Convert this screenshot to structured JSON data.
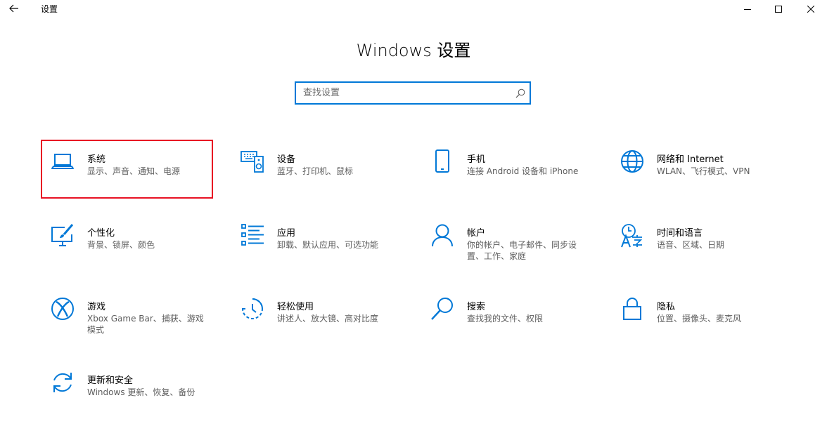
{
  "window": {
    "app_title": "设置",
    "back_icon": "back-arrow-icon",
    "minimize_icon": "minimize-icon",
    "maximize_icon": "maximize-icon",
    "close_icon": "close-icon"
  },
  "page_title": "Windows 设置",
  "search": {
    "placeholder": "查找设置",
    "value": ""
  },
  "accent_color": "#0078d7",
  "highlight_color": "#e81123",
  "selected_tile": "系统",
  "categories": [
    {
      "name": "系统",
      "desc": "显示、声音、通知、电源",
      "icon": "laptop-icon"
    },
    {
      "name": "设备",
      "desc": "蓝牙、打印机、鼠标",
      "icon": "keyboard-speaker-icon"
    },
    {
      "name": "手机",
      "desc": "连接 Android 设备和 iPhone",
      "icon": "phone-icon"
    },
    {
      "name": "网络和 Internet",
      "desc": "WLAN、飞行模式、VPN",
      "icon": "globe-icon"
    },
    {
      "name": "个性化",
      "desc": "背景、锁屏、颜色",
      "icon": "paint-monitor-icon"
    },
    {
      "name": "应用",
      "desc": "卸载、默认应用、可选功能",
      "icon": "app-list-icon"
    },
    {
      "name": "帐户",
      "desc": "你的帐户、电子邮件、同步设置、工作、家庭",
      "icon": "person-icon"
    },
    {
      "name": "时间和语言",
      "desc": "语音、区域、日期",
      "icon": "time-language-icon"
    },
    {
      "name": "游戏",
      "desc": "Xbox Game Bar、捕获、游戏模式",
      "icon": "xbox-icon"
    },
    {
      "name": "轻松使用",
      "desc": "讲述人、放大镜、高对比度",
      "icon": "ease-of-access-icon"
    },
    {
      "name": "搜索",
      "desc": "查找我的文件、权限",
      "icon": "magnifier-icon"
    },
    {
      "name": "隐私",
      "desc": "位置、摄像头、麦克风",
      "icon": "lock-icon"
    },
    {
      "name": "更新和安全",
      "desc": "Windows 更新、恢复、备份",
      "icon": "sync-icon"
    }
  ]
}
